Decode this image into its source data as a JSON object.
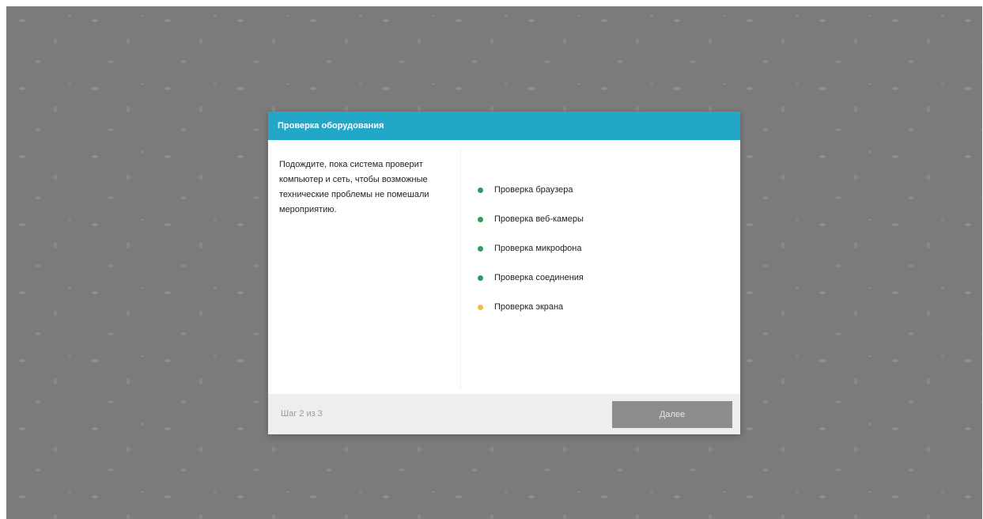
{
  "modal": {
    "title": "Проверка оборудования",
    "description": "Подождите, пока система проверит компьютер и сеть, чтобы возможные технические проблемы не помешали мероприятию.",
    "checks": [
      {
        "label": "Проверка браузера",
        "status": "done",
        "color": "#2e9e5b"
      },
      {
        "label": "Проверка веб-камеры",
        "status": "done",
        "color": "#2e9e5b"
      },
      {
        "label": "Проверка микрофона",
        "status": "done",
        "color": "#2e9e5b"
      },
      {
        "label": "Проверка соединения",
        "status": "done",
        "color": "#2e9e5b"
      },
      {
        "label": "Проверка экрана",
        "status": "in-progress",
        "color": "#f5b84e"
      }
    ],
    "footer": {
      "step_text": "Шаг 2 из 3",
      "next_label": "Далее"
    }
  },
  "colors": {
    "header_bg": "#23a7c9",
    "backdrop": "#7b7b7b",
    "button_disabled": "#8d8d8d"
  }
}
